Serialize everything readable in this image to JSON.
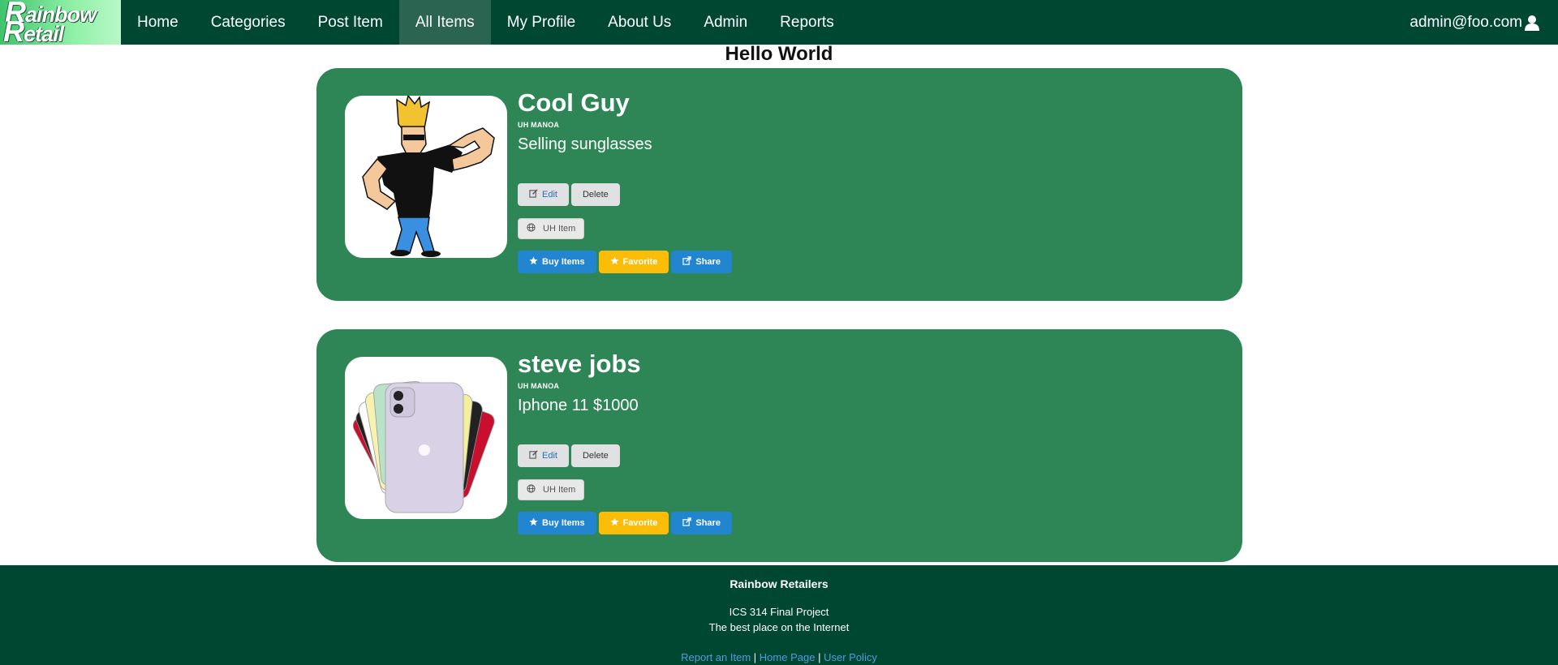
{
  "nav": {
    "logo": {
      "line1": "ainbow",
      "line1_initial": "R",
      "line2": "etail",
      "line2_initial": "R"
    },
    "items": [
      {
        "label": "Home"
      },
      {
        "label": "Categories"
      },
      {
        "label": "Post Item"
      },
      {
        "label": "All Items",
        "active": true
      },
      {
        "label": "My Profile"
      },
      {
        "label": "About Us"
      },
      {
        "label": "Admin"
      },
      {
        "label": "Reports"
      }
    ],
    "user_email": "admin@foo.com",
    "user_icon": "user-icon"
  },
  "page": {
    "heading": "Hello World"
  },
  "items": [
    {
      "title": "Cool Guy",
      "school": "UH MANOA",
      "description": "Selling sunglasses",
      "image_icon": "cartoon-man-image",
      "edit_label": "Edit",
      "delete_label": "Delete",
      "tag_label": "UH Item",
      "buy_label": "Buy Items",
      "favorite_label": "Favorite",
      "share_label": "Share"
    },
    {
      "title": "steve jobs",
      "school": "UH MANOA",
      "description": "Iphone 11 $1000",
      "image_icon": "iphone-image",
      "edit_label": "Edit",
      "delete_label": "Delete",
      "tag_label": "UH Item",
      "buy_label": "Buy Items",
      "favorite_label": "Favorite",
      "share_label": "Share"
    }
  ],
  "footer": {
    "title": "Rainbow Retailers",
    "line1": "ICS 314 Final Project",
    "line2": "The best place on the Internet",
    "links": [
      "Report an Item",
      "Home Page",
      "User Policy"
    ],
    "separator": "|"
  },
  "colors": {
    "nav_bg": "#004731",
    "card_bg": "#2e8656",
    "primary": "#2185d0",
    "favorite": "#fbbd08"
  }
}
